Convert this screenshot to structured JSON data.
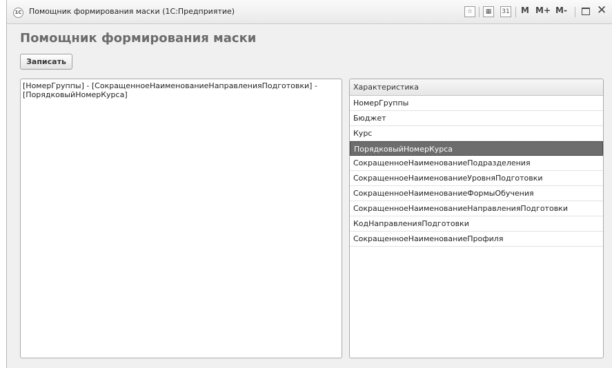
{
  "window": {
    "title": "Помощник формирования маски  (1С:Предприятие)",
    "logo_text": "1С",
    "toolbar": {
      "fav_icon": "star-icon",
      "calc_icon": "calculator-icon",
      "calendar_icon": "calendar-icon",
      "calendar_text": "31",
      "m_label": "M",
      "mplus_label": "M+",
      "mminus_label": "M-",
      "maximize_icon": "maximize-icon",
      "close_icon": "close-icon"
    }
  },
  "form": {
    "title": "Помощник формирования маски",
    "write_button": "Записать",
    "mask_text": "[НомерГруппы] - [СокращенноеНаименованиеНаправленияПодготовки] - [ПорядковыйНомерКурса]"
  },
  "grid": {
    "header": "Характеристика",
    "rows": [
      "НомерГруппы",
      "Бюджет",
      "Курс",
      "ПорядковыйНомерКурса",
      "СокращенноеНаименованиеПодразделения",
      "СокращенноеНаименованиеУровняПодготовки",
      "СокращенноеНаименованиеФормыОбучения",
      "СокращенноеНаименованиеНаправленияПодготовки",
      "КодНаправленияПодготовки",
      "СокращенноеНаименованиеПрофиля"
    ],
    "selected_index": 3
  }
}
